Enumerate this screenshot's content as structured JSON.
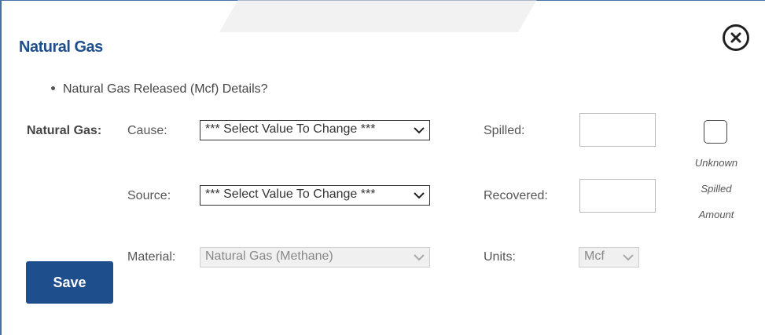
{
  "dialog": {
    "title": "Natural Gas",
    "question": "Natural Gas Released (Mcf) Details?"
  },
  "form": {
    "section_label": "Natural Gas:",
    "cause_label": "Cause:",
    "cause_value": "*** Select Value To Change ***",
    "source_label": "Source:",
    "source_value": "*** Select Value To Change ***",
    "material_label": "Material:",
    "material_value": "Natural Gas (Methane)",
    "spilled_label": "Spilled:",
    "recovered_label": "Recovered:",
    "units_label": "Units:",
    "units_value": "Mcf",
    "unknown_line1": "Unknown",
    "unknown_line2": "Spilled",
    "unknown_line3": "Amount"
  },
  "buttons": {
    "save_label": "Save"
  },
  "colors": {
    "accent": "#1f4e8c"
  },
  "icons": {
    "close": "close-circle-icon",
    "chevron": "chevron-down-icon"
  }
}
